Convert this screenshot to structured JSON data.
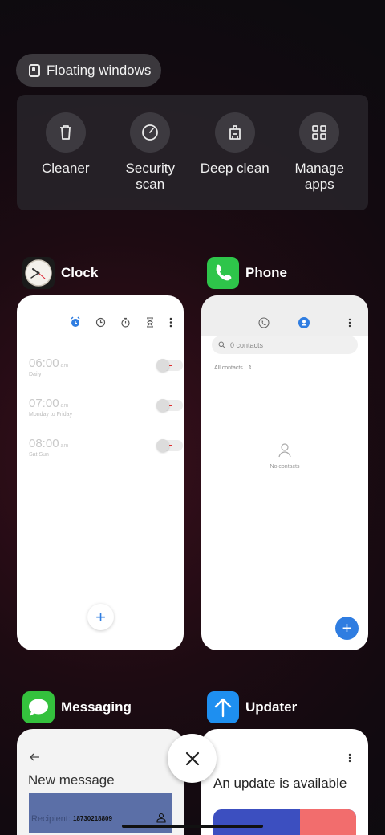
{
  "floating_windows": {
    "label": "Floating windows",
    "icon": "floating-window-icon"
  },
  "tools": [
    {
      "label": "Cleaner",
      "icon": "trash-icon"
    },
    {
      "label": "Security\nscan",
      "icon": "security-scan-icon"
    },
    {
      "label": "Deep clean",
      "icon": "deep-clean-icon"
    },
    {
      "label": "Manage\napps",
      "icon": "grid-icon"
    }
  ],
  "apps": {
    "clock": {
      "name": "Clock",
      "alarms": [
        {
          "time": "06:00",
          "ampm": "am",
          "repeat": "Daily"
        },
        {
          "time": "07:00",
          "ampm": "am",
          "repeat": "Monday to Friday"
        },
        {
          "time": "08:00",
          "ampm": "am",
          "repeat": "Sat Sun"
        }
      ],
      "fab": "+"
    },
    "phone": {
      "name": "Phone",
      "search_placeholder": "0 contacts",
      "filter": "All contacts",
      "empty": "No contacts",
      "fab": "+"
    },
    "messaging": {
      "name": "Messaging",
      "title": "New message",
      "recipient_label": "Recipient:",
      "recipient_value": "18730218809"
    },
    "updater": {
      "name": "Updater",
      "title": "An update is available"
    }
  },
  "colors": {
    "accent_blue": "#2f7de1",
    "phone_green": "#2ec54a",
    "messaging_green": "#34c13d",
    "updater_blue": "#1e8ff0"
  }
}
